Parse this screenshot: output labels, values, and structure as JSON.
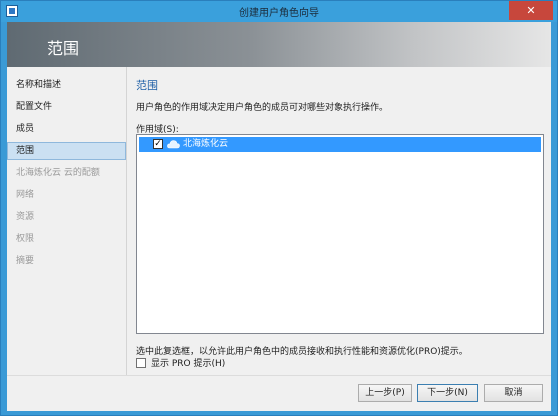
{
  "window": {
    "title": "创建用户角色向导",
    "close_glyph": "✕"
  },
  "header": {
    "title": "范围"
  },
  "sidebar": {
    "items": [
      {
        "label": "名称和描述",
        "state": "normal"
      },
      {
        "label": "配置文件",
        "state": "normal"
      },
      {
        "label": "成员",
        "state": "normal"
      },
      {
        "label": "范围",
        "state": "selected"
      },
      {
        "label": "北海炼化云 云的配额",
        "state": "disabled"
      },
      {
        "label": "网络",
        "state": "disabled"
      },
      {
        "label": "资源",
        "state": "disabled"
      },
      {
        "label": "权限",
        "state": "disabled"
      },
      {
        "label": "摘要",
        "state": "disabled"
      }
    ]
  },
  "main": {
    "section_title": "范围",
    "description": "用户角色的作用域决定用户角色的成员可对哪些对象执行操作。",
    "scope_label": "作用域(S):",
    "scope_items": [
      {
        "label": "北海炼化云",
        "checked": true,
        "icon": "cloud-icon",
        "check_glyph": "✓"
      }
    ],
    "pro_description": "选中此复选框，以允许此用户角色中的成员接收和执行性能和资源优化(PRO)提示。",
    "pro_checkbox": {
      "label": "显示 PRO 提示(H)",
      "checked": false
    }
  },
  "buttons": {
    "previous": "上一步(P)",
    "next": "下一步(N)",
    "cancel": "取消"
  },
  "colors": {
    "accent": "#3399ff",
    "titlebar": "#3aa0dc",
    "close": "#c7473c",
    "section_title": "#1e5fa6"
  }
}
